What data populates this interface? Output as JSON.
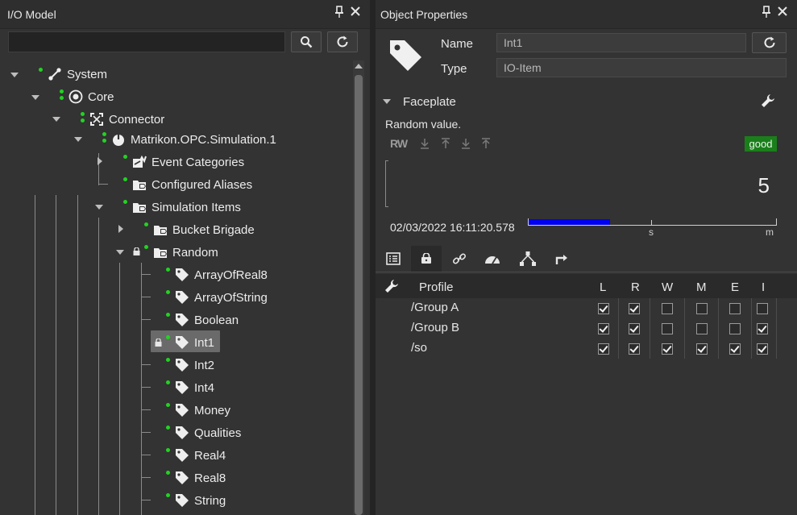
{
  "left": {
    "title": "I/O Model",
    "search": {
      "value": "",
      "placeholder": ""
    },
    "tree": [
      {
        "label": "System",
        "icon": "system-icon"
      },
      {
        "label": "Core",
        "icon": "core-icon"
      },
      {
        "label": "Connector",
        "icon": "connector-icon"
      },
      {
        "label": "Matrikon.OPC.Simulation.1",
        "icon": "power-icon"
      },
      {
        "label": "Event Categories",
        "icon": "event-categories-icon"
      },
      {
        "label": "Configured Aliases",
        "icon": "folder-icon"
      },
      {
        "label": "Simulation Items",
        "icon": "folder-icon"
      },
      {
        "label": "Bucket Brigade",
        "icon": "folder-icon"
      },
      {
        "label": "Random",
        "icon": "folder-icon"
      },
      {
        "label": "ArrayOfReal8",
        "icon": "tag-icon"
      },
      {
        "label": "ArrayOfString",
        "icon": "tag-icon"
      },
      {
        "label": "Boolean",
        "icon": "tag-icon"
      },
      {
        "label": "Int1",
        "icon": "tag-icon"
      },
      {
        "label": "Int2",
        "icon": "tag-icon"
      },
      {
        "label": "Int4",
        "icon": "tag-icon"
      },
      {
        "label": "Money",
        "icon": "tag-icon"
      },
      {
        "label": "Qualities",
        "icon": "tag-icon"
      },
      {
        "label": "Real4",
        "icon": "tag-icon"
      },
      {
        "label": "Real8",
        "icon": "tag-icon"
      },
      {
        "label": "String",
        "icon": "tag-icon"
      }
    ]
  },
  "right": {
    "title": "Object Properties",
    "name_label": "Name",
    "name_value": "Int1",
    "type_label": "Type",
    "type_value": "IO-Item",
    "faceplate": {
      "title": "Faceplate",
      "description": "Random value.",
      "rw": "RW",
      "quality": "good",
      "value": "5",
      "timestamp": "02/03/2022 16:11:20.578",
      "timeline_s": "s",
      "timeline_m": "m",
      "timeline_fill_fraction": 0.33
    },
    "tabs": [
      "details-icon",
      "lock-icon",
      "link-icon",
      "gauge-icon",
      "hierarchy-icon",
      "turn-icon"
    ],
    "grid": {
      "header": {
        "profile": "Profile",
        "cols": [
          "L",
          "R",
          "W",
          "M",
          "E",
          "I"
        ]
      },
      "rows": [
        {
          "name": "/Group A",
          "checks": [
            true,
            true,
            false,
            false,
            false,
            false
          ]
        },
        {
          "name": "/Group B",
          "checks": [
            true,
            true,
            false,
            false,
            false,
            true
          ]
        },
        {
          "name": "/so",
          "checks": [
            true,
            true,
            true,
            true,
            true,
            true
          ]
        }
      ]
    }
  },
  "colors": {
    "accent_green": "#22d322",
    "quality_good": "#1a7f1a",
    "timeline_blue": "#0000f0"
  }
}
